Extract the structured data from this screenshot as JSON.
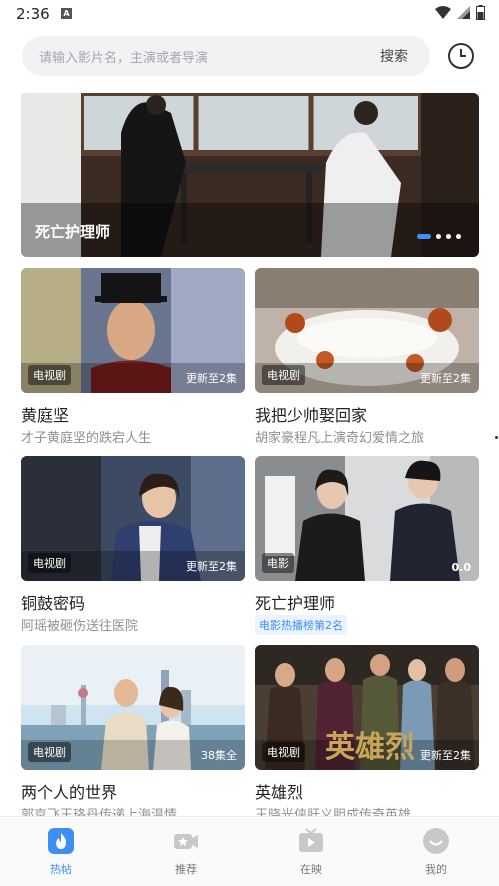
{
  "status_bar": {
    "time": "2:36",
    "a_badge": "A"
  },
  "search": {
    "placeholder": "请输入影片名，主演或者导演",
    "button_label": "搜索"
  },
  "banner": {
    "title": "死亡护理师",
    "dot_count": 4,
    "active_dot": 0
  },
  "cards": [
    {
      "title": "黄庭坚",
      "desc": "才子黄庭坚的跌宕人生",
      "tag": "电视剧",
      "update": "更新至2集"
    },
    {
      "title": "我把少帅娶回家",
      "desc": "胡家豪程凡上演奇幻爱情之旅",
      "tag": "电视剧",
      "update": "更新至2集"
    },
    {
      "title": "铜鼓密码",
      "desc": "阿瑶被砸伤送往医院",
      "tag": "电视剧",
      "update": "更新至2集"
    },
    {
      "title": "死亡护理师",
      "rank": "电影热播榜第2名",
      "tag": "电影",
      "update": "0.0"
    },
    {
      "title": "两个人的世界",
      "desc": "郭京飞王珞丹传递上海温情",
      "tag": "电视剧",
      "update": "38集全"
    },
    {
      "title": "英雄烈",
      "desc": "王晓光侠肝义胆成传奇英雄",
      "tag": "电视剧",
      "update": "更新至2集",
      "poster_text": "英雄烈"
    }
  ],
  "bottom_nav": [
    {
      "label": "热帖",
      "icon": "flame-icon",
      "active": true
    },
    {
      "label": "推荐",
      "icon": "video-camera-icon",
      "active": false
    },
    {
      "label": "在映",
      "icon": "tv-play-icon",
      "active": false
    },
    {
      "label": "我的",
      "icon": "smile-face-icon",
      "active": false
    }
  ],
  "colors": {
    "accent": "#3d8ff5",
    "text_primary": "#222222",
    "text_secondary": "#8d9096",
    "search_bg": "#f1f2f4"
  }
}
